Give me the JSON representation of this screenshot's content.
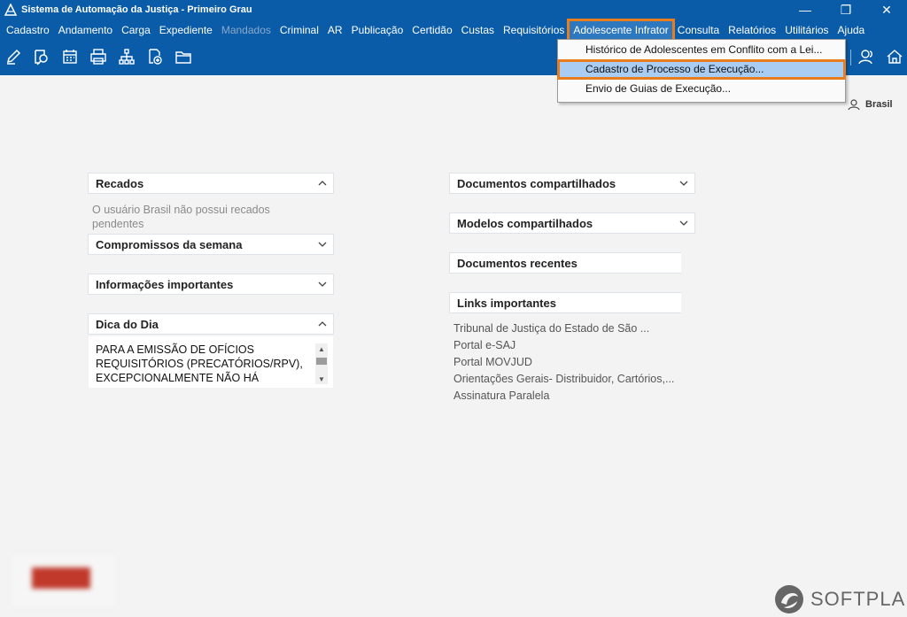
{
  "window": {
    "title": "Sistema de Automação da Justiça - Primeiro Grau",
    "minimize": "—",
    "restore": "❐",
    "close": "✕"
  },
  "menu": [
    {
      "label": "Cadastro",
      "state": "normal"
    },
    {
      "label": "Andamento",
      "state": "normal"
    },
    {
      "label": "Carga",
      "state": "normal"
    },
    {
      "label": "Expediente",
      "state": "normal"
    },
    {
      "label": "Mandados",
      "state": "disabled"
    },
    {
      "label": "Criminal",
      "state": "normal"
    },
    {
      "label": "AR",
      "state": "normal"
    },
    {
      "label": "Publicação",
      "state": "normal"
    },
    {
      "label": "Certidão",
      "state": "normal"
    },
    {
      "label": "Custas",
      "state": "normal"
    },
    {
      "label": "Requisitórios",
      "state": "normal"
    },
    {
      "label": "Adolescente Infrator",
      "state": "active"
    },
    {
      "label": "Consulta",
      "state": "normal"
    },
    {
      "label": "Relatórios",
      "state": "normal"
    },
    {
      "label": "Utilitários",
      "state": "normal"
    },
    {
      "label": "Ajuda",
      "state": "normal"
    }
  ],
  "toolbar_icons": [
    "edit-icon",
    "search-doc-icon",
    "calendar-icon",
    "printer-icon",
    "hierarchy-icon",
    "add-document-icon",
    "folder-icon",
    "users-icon",
    "home-icon"
  ],
  "dropdown": [
    {
      "label": "Histórico de Adolescentes em Conflito com a Lei...",
      "highlighted": false
    },
    {
      "label": "Cadastro de Processo de Execução...",
      "highlighted": true
    },
    {
      "label": "Envio de Guias de Execução...",
      "highlighted": false
    }
  ],
  "user": {
    "name": "Brasil"
  },
  "left_panels": {
    "recados": {
      "title": "Recados",
      "body": "O usuário Brasil não possui recados pendentes"
    },
    "compromissos": {
      "title": "Compromissos da semana"
    },
    "informacoes": {
      "title": "Informações importantes"
    },
    "dica": {
      "title": "Dica do Dia",
      "body": "PARA A EMISSÃO DE OFÍCIOS REQUISITÓRIOS (PRECATÓRIOS/RPV), EXCEPCIONALMENTE NÃO HÁ"
    }
  },
  "right_panels": {
    "docs_compartilhados": {
      "title": "Documentos compartilhados"
    },
    "modelos": {
      "title": "Modelos compartilhados"
    },
    "docs_recentes": {
      "title": "Documentos recentes"
    },
    "links": {
      "title": "Links importantes",
      "items": [
        "Tribunal de Justiça do Estado de São ...",
        "Portal e-SAJ",
        "Portal MOVJUD",
        "Orientações Gerais- Distribuidor, Cartórios,...",
        "Assinatura Paralela"
      ]
    }
  },
  "brand": {
    "name": "SOFTPLAN"
  },
  "colors": {
    "primary": "#0a5ca8",
    "highlight": "#e87d1e",
    "selection": "#a9cdf2"
  }
}
